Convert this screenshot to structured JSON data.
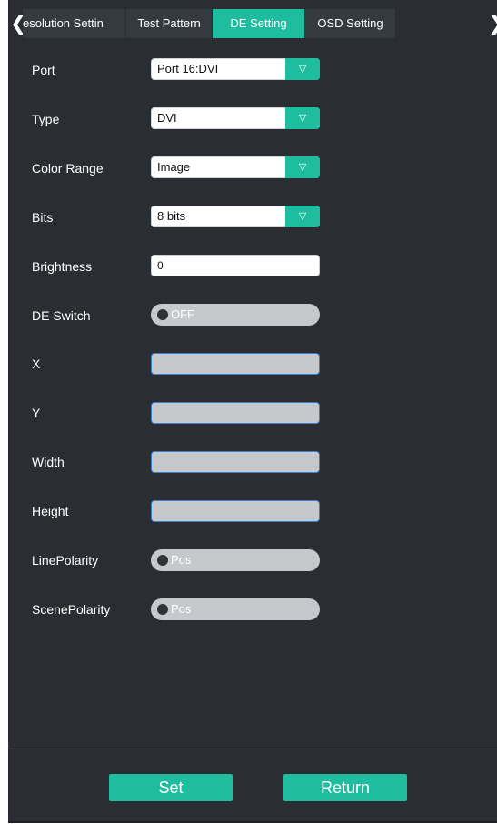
{
  "tabs": [
    {
      "label": "esolution Settin",
      "active": false
    },
    {
      "label": "Test Pattern",
      "active": false
    },
    {
      "label": "DE Setting",
      "active": true
    },
    {
      "label": "OSD Setting",
      "active": false
    }
  ],
  "nav": {
    "left_icon": "chevron-left-icon",
    "right_icon": "chevron-right-icon"
  },
  "form": {
    "port": {
      "label": "Port",
      "value": "Port 16:DVI"
    },
    "type": {
      "label": "Type",
      "value": "DVI"
    },
    "color_range": {
      "label": "Color Range",
      "value": "Image"
    },
    "bits": {
      "label": "Bits",
      "value": "8 bits"
    },
    "brightness": {
      "label": "Brightness",
      "value": "0"
    },
    "de_switch": {
      "label": "DE Switch",
      "state": "OFF"
    },
    "x": {
      "label": "X",
      "value": ""
    },
    "y": {
      "label": "Y",
      "value": ""
    },
    "width": {
      "label": "Width",
      "value": ""
    },
    "height": {
      "label": "Height",
      "value": ""
    },
    "line_polarity": {
      "label": "LinePolarity",
      "state": "Pos"
    },
    "scene_polarity": {
      "label": "ScenePolarity",
      "state": "Pos"
    }
  },
  "dropdown_arrow": "▽",
  "buttons": {
    "set": "Set",
    "return": "Return"
  },
  "colors": {
    "accent": "#1ebd9f",
    "panel_bg": "#2a2e33",
    "tab_bg": "#353a40",
    "disabled_field": "#c6c9cc",
    "field_border_focus": "#3b7fd4"
  }
}
